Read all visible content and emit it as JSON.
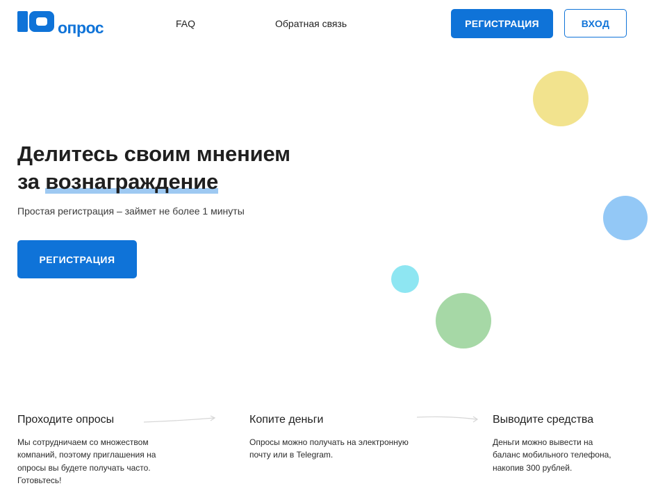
{
  "header": {
    "logo_text": "опрос",
    "nav": {
      "faq": "FAQ",
      "feedback": "Обратная связь"
    },
    "register_button": "РЕГИСТРАЦИЯ",
    "login_button": "ВХОД"
  },
  "hero": {
    "title_line1": "Делитесь своим мнением",
    "title_line2_prefix": "за ",
    "title_line2_highlight": "вознаграждение",
    "subtitle": "Простая регистрация – займет не более 1 минуты",
    "register_button": "РЕГИСТРАЦИЯ"
  },
  "decor": {
    "colors": [
      "#f2e38e",
      "#93c8f6",
      "#8ee6f2",
      "#a6d8a6"
    ]
  },
  "steps": [
    {
      "title": "Проходите опросы",
      "text": "Мы сотрудничаем со множеством компаний, поэтому приглашения на опросы вы будете получать часто. Готовьтесь!"
    },
    {
      "title": "Копите деньги",
      "text": "Опросы можно получать на электронную почту или в Telegram."
    },
    {
      "title": "Выводите средства",
      "text": "Деньги можно вывести на баланс мобильного телефона, накопив 300 рублей."
    }
  ],
  "colors": {
    "accent": "#0f73d8",
    "highlight": "#9ec9f2"
  }
}
